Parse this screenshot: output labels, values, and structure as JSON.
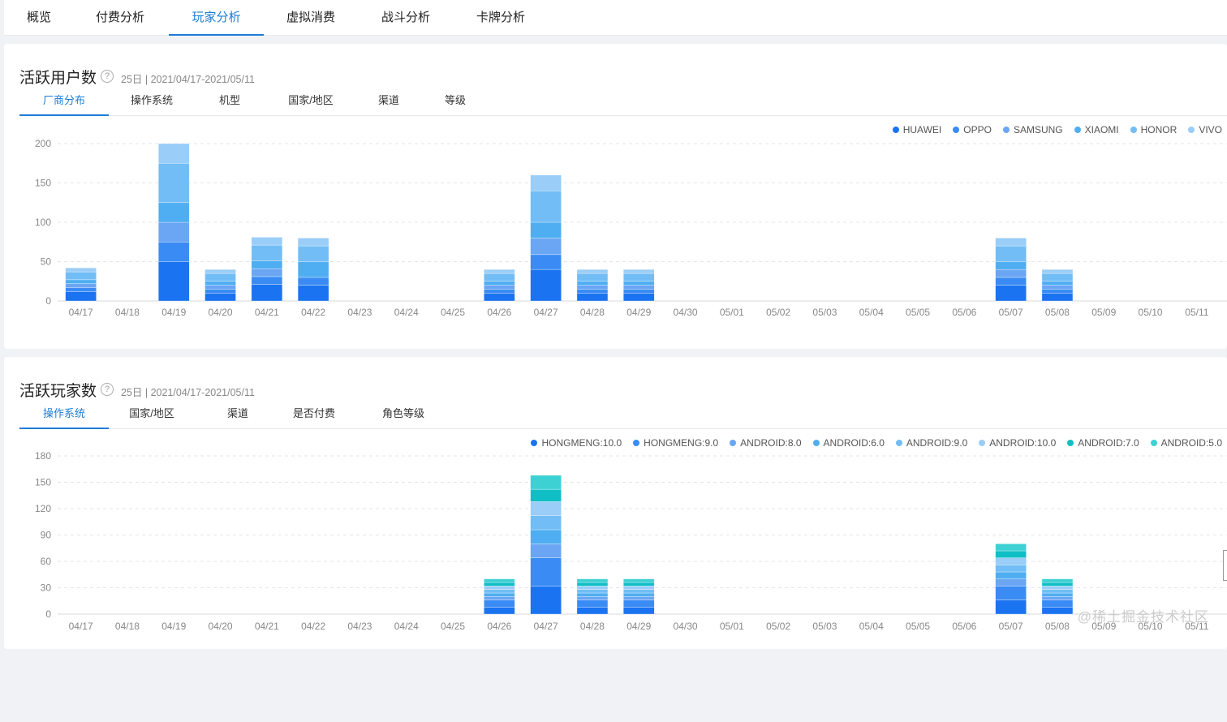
{
  "nav": {
    "tabs": [
      {
        "label": "概览",
        "active": false
      },
      {
        "label": "付费分析",
        "active": false
      },
      {
        "label": "玩家分析",
        "active": true
      },
      {
        "label": "虚拟消费",
        "active": false
      },
      {
        "label": "战斗分析",
        "active": false
      },
      {
        "label": "卡牌分析",
        "active": false
      }
    ]
  },
  "panel1": {
    "title": "活跃用户数",
    "help_icon": "question-circle-icon",
    "subtitle": "25日 | 2021/04/17-2021/05/11",
    "tabs": [
      {
        "label": "厂商分布",
        "active": true
      },
      {
        "label": "操作系统",
        "active": false
      },
      {
        "label": "机型",
        "active": false
      },
      {
        "label": "国家/地区",
        "active": false
      },
      {
        "label": "渠道",
        "active": false
      },
      {
        "label": "等级",
        "active": false
      }
    ]
  },
  "panel2": {
    "title": "活跃玩家数",
    "help_icon": "question-circle-icon",
    "subtitle": "25日 | 2021/04/17-2021/05/11",
    "tabs": [
      {
        "label": "操作系统",
        "active": true
      },
      {
        "label": "国家/地区",
        "active": false
      },
      {
        "label": "渠道",
        "active": false
      },
      {
        "label": "是否付费",
        "active": false
      },
      {
        "label": "角色等级",
        "active": false
      }
    ]
  },
  "chart_data": [
    {
      "type": "bar",
      "stacked": true,
      "categories": [
        "04/17",
        "04/18",
        "04/19",
        "04/20",
        "04/21",
        "04/22",
        "04/23",
        "04/24",
        "04/25",
        "04/26",
        "04/27",
        "04/28",
        "04/29",
        "04/30",
        "05/01",
        "05/02",
        "05/03",
        "05/04",
        "05/05",
        "05/06",
        "05/07",
        "05/08",
        "05/09",
        "05/10",
        "05/11"
      ],
      "ylim": [
        0,
        200
      ],
      "yticks": [
        0,
        50,
        100,
        150,
        200
      ],
      "grid": true,
      "legend_position": "top-right",
      "series": [
        {
          "name": "HUAWEI",
          "color": "#1a73f0",
          "values": [
            12,
            0,
            50,
            10,
            21,
            20,
            0,
            0,
            0,
            10,
            40,
            10,
            10,
            0,
            0,
            0,
            0,
            0,
            0,
            0,
            20,
            10,
            0,
            0,
            0
          ]
        },
        {
          "name": "OPPO",
          "color": "#3a8cf4",
          "values": [
            5,
            0,
            25,
            5,
            10,
            10,
            0,
            0,
            0,
            5,
            19,
            5,
            5,
            0,
            0,
            0,
            0,
            0,
            0,
            0,
            10,
            5,
            0,
            0,
            0
          ]
        },
        {
          "name": "SAMSUNG",
          "color": "#6aa6f3",
          "values": [
            5,
            0,
            25,
            5,
            10,
            0,
            0,
            0,
            0,
            5,
            21,
            5,
            5,
            0,
            0,
            0,
            0,
            0,
            0,
            0,
            10,
            5,
            0,
            0,
            0
          ]
        },
        {
          "name": "XIAOMI",
          "color": "#4faef1",
          "values": [
            5,
            0,
            25,
            5,
            10,
            20,
            0,
            0,
            0,
            5,
            20,
            5,
            5,
            0,
            0,
            0,
            0,
            0,
            0,
            0,
            10,
            5,
            0,
            0,
            0
          ]
        },
        {
          "name": "HONOR",
          "color": "#72bdf5",
          "values": [
            10,
            0,
            50,
            10,
            20,
            20,
            0,
            0,
            0,
            10,
            40,
            10,
            10,
            0,
            0,
            0,
            0,
            0,
            0,
            0,
            20,
            10,
            0,
            0,
            0
          ]
        },
        {
          "name": "VIVO",
          "color": "#9acdf7",
          "values": [
            5,
            0,
            25,
            5,
            10,
            10,
            0,
            0,
            0,
            5,
            20,
            5,
            5,
            0,
            0,
            0,
            0,
            0,
            0,
            0,
            10,
            5,
            0,
            0,
            0
          ]
        }
      ]
    },
    {
      "type": "bar",
      "stacked": true,
      "categories": [
        "04/17",
        "04/18",
        "04/19",
        "04/20",
        "04/21",
        "04/22",
        "04/23",
        "04/24",
        "04/25",
        "04/26",
        "04/27",
        "04/28",
        "04/29",
        "04/30",
        "05/01",
        "05/02",
        "05/03",
        "05/04",
        "05/05",
        "05/06",
        "05/07",
        "05/08",
        "05/09",
        "05/10",
        "05/11"
      ],
      "ylim": [
        0,
        180
      ],
      "yticks": [
        0,
        30,
        60,
        90,
        120,
        150,
        180
      ],
      "grid": true,
      "legend_position": "top-right",
      "series": [
        {
          "name": "HONGMENG:10.0",
          "color": "#1a73f0",
          "values": [
            0,
            0,
            0,
            0,
            0,
            0,
            0,
            0,
            0,
            8,
            32,
            8,
            8,
            0,
            0,
            0,
            0,
            0,
            0,
            0,
            16,
            8,
            0,
            0,
            0
          ]
        },
        {
          "name": "HONGMENG:9.0",
          "color": "#3a8cf4",
          "values": [
            0,
            0,
            0,
            0,
            0,
            0,
            0,
            0,
            0,
            8,
            32,
            8,
            8,
            0,
            0,
            0,
            0,
            0,
            0,
            0,
            16,
            8,
            0,
            0,
            0
          ]
        },
        {
          "name": "ANDROID:8.0",
          "color": "#6aa6f3",
          "values": [
            0,
            0,
            0,
            0,
            0,
            0,
            0,
            0,
            0,
            4,
            16,
            4,
            4,
            0,
            0,
            0,
            0,
            0,
            0,
            0,
            8,
            4,
            0,
            0,
            0
          ]
        },
        {
          "name": "ANDROID:6.0",
          "color": "#4faef1",
          "values": [
            0,
            0,
            0,
            0,
            0,
            0,
            0,
            0,
            0,
            4,
            16,
            4,
            4,
            0,
            0,
            0,
            0,
            0,
            0,
            0,
            8,
            4,
            0,
            0,
            0
          ]
        },
        {
          "name": "ANDROID:9.0",
          "color": "#72bdf5",
          "values": [
            0,
            0,
            0,
            0,
            0,
            0,
            0,
            0,
            0,
            4,
            16,
            4,
            4,
            0,
            0,
            0,
            0,
            0,
            0,
            0,
            8,
            4,
            0,
            0,
            0
          ]
        },
        {
          "name": "ANDROID:10.0",
          "color": "#9acdf7",
          "values": [
            0,
            0,
            0,
            0,
            0,
            0,
            0,
            0,
            0,
            4,
            16,
            4,
            4,
            0,
            0,
            0,
            0,
            0,
            0,
            0,
            8,
            4,
            0,
            0,
            0
          ]
        },
        {
          "name": "ANDROID:7.0",
          "color": "#10bfc6",
          "values": [
            0,
            0,
            0,
            0,
            0,
            0,
            0,
            0,
            0,
            4,
            14,
            4,
            4,
            0,
            0,
            0,
            0,
            0,
            0,
            0,
            8,
            4,
            0,
            0,
            0
          ]
        },
        {
          "name": "ANDROID:5.0",
          "color": "#3dd1d4",
          "values": [
            0,
            0,
            0,
            0,
            0,
            0,
            0,
            0,
            0,
            4,
            16,
            4,
            4,
            0,
            0,
            0,
            0,
            0,
            0,
            0,
            8,
            4,
            0,
            0,
            0
          ]
        }
      ]
    }
  ],
  "watermark": "@稀土掘金技术社区"
}
